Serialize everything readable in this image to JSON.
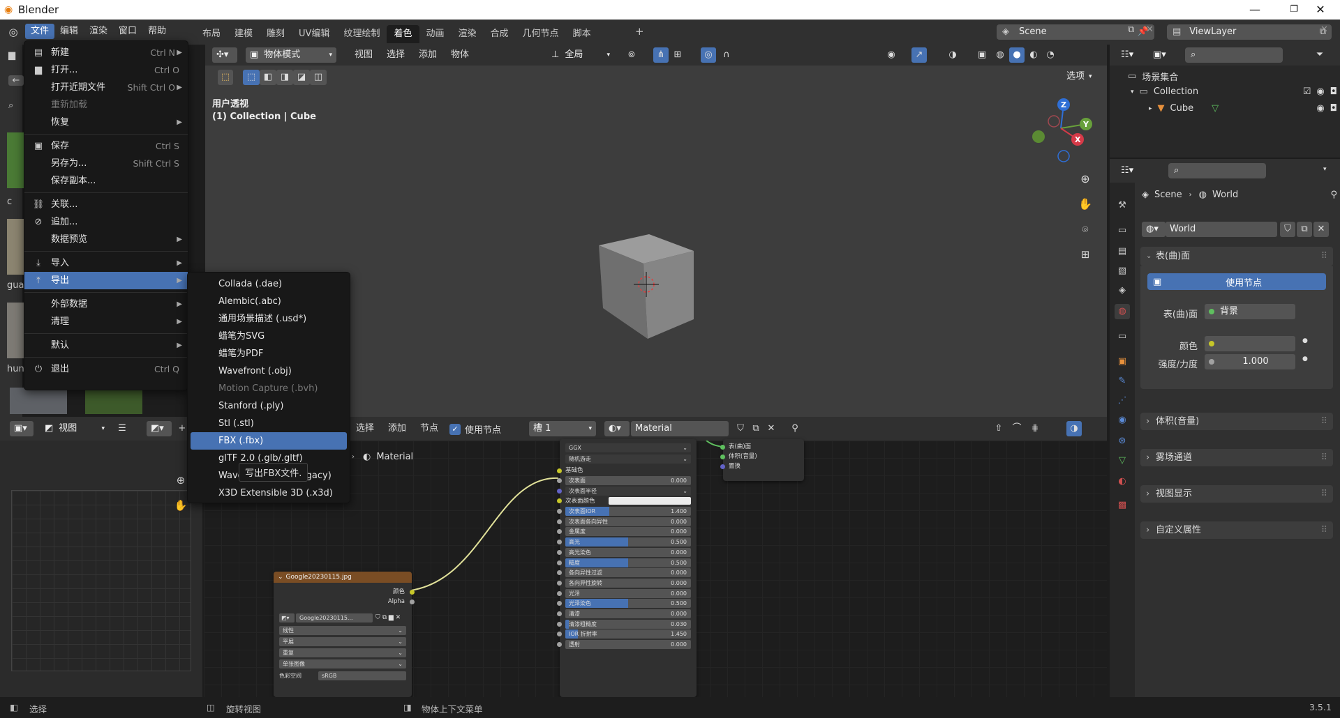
{
  "window": {
    "title": "Blender"
  },
  "topbar": {
    "menus": [
      "文件",
      "编辑",
      "渲染",
      "窗口",
      "帮助"
    ],
    "workspaces": [
      "布局",
      "建模",
      "雕刻",
      "UV编辑",
      "纹理绘制",
      "着色",
      "动画",
      "渲染",
      "合成",
      "几何节点",
      "脚本"
    ],
    "active_workspace": "着色",
    "scene": "Scene",
    "view_layer": "ViewLayer"
  },
  "file_menu": {
    "items": [
      {
        "label": "新建",
        "shortcut": "Ctrl N",
        "icon": "new-file-icon",
        "submenu": true
      },
      {
        "label": "打开...",
        "shortcut": "Ctrl O",
        "icon": "folder-icon"
      },
      {
        "label": "打开近期文件",
        "shortcut": "Shift Ctrl O",
        "submenu": true
      },
      {
        "label": "重新加载",
        "disabled": true
      },
      {
        "label": "恢复",
        "submenu": true
      },
      {
        "label": "保存",
        "shortcut": "Ctrl S",
        "icon": "save-icon",
        "sep_before": true
      },
      {
        "label": "另存为...",
        "shortcut": "Shift Ctrl S"
      },
      {
        "label": "保存副本..."
      },
      {
        "label": "关联...",
        "icon": "link-icon",
        "sep_before": true
      },
      {
        "label": "追加...",
        "icon": "append-icon"
      },
      {
        "label": "数据预览",
        "submenu": true
      },
      {
        "label": "导入",
        "icon": "import-icon",
        "submenu": true,
        "sep_before": true
      },
      {
        "label": "导出",
        "icon": "export-icon",
        "submenu": true,
        "highlight": true
      },
      {
        "label": "外部数据",
        "submenu": true,
        "sep_before": true
      },
      {
        "label": "清理",
        "submenu": true
      },
      {
        "label": "默认",
        "submenu": true,
        "sep_before": true
      },
      {
        "label": "退出",
        "shortcut": "Ctrl Q",
        "icon": "power-icon",
        "sep_before": true
      }
    ]
  },
  "export_menu": {
    "items": [
      {
        "label": "Collada (.dae)"
      },
      {
        "label": "Alembic(.abc)"
      },
      {
        "label": "通用场景描述 (.usd*)"
      },
      {
        "label": "蜡笔为SVG"
      },
      {
        "label": "蜡笔为PDF"
      },
      {
        "label": "Wavefront (.obj)"
      },
      {
        "label": "Motion Capture (.bvh)",
        "disabled": true
      },
      {
        "label": "Stanford (.ply)"
      },
      {
        "label": "Stl (.stl)"
      },
      {
        "label": "FBX (.fbx)",
        "highlight": true
      },
      {
        "label": "glTF 2.0 (.glb/.gltf)"
      },
      {
        "label": "Wavefront (.obj) (legacy)"
      },
      {
        "label": "X3D Extensible 3D (.x3d)"
      }
    ],
    "tooltip": "写出FBX文件."
  },
  "viewport": {
    "mode": "物体模式",
    "menus": [
      "视图",
      "选择",
      "添加",
      "物体"
    ],
    "transform": "全局",
    "options": "选项",
    "view_name": "用户透视",
    "context": "(1) Collection | Cube",
    "axes": {
      "x": "X",
      "y": "Y",
      "z": "Z"
    }
  },
  "left_panel": {
    "thumbs": [
      "c",
      "gua",
      "hun"
    ]
  },
  "image_editor": {
    "view": "视图"
  },
  "node_editor": {
    "menus": [
      "选择",
      "添加",
      "节点"
    ],
    "use_nodes": "使用节点",
    "slot": "槽 1",
    "material": "Material",
    "breadcrumb": "Material",
    "image_node": {
      "title": "Google20230115.jpg",
      "outputs": [
        "颜色",
        "Alpha"
      ],
      "image": "Google20230115...",
      "dropdowns": [
        "线性",
        "平展",
        "重复",
        "单张图像"
      ],
      "colorspace_label": "色彩空间",
      "colorspace": "sRGB"
    },
    "bsdf": {
      "dropdowns": [
        "GGX",
        "随机游走"
      ],
      "base_color": "基础色",
      "rows": [
        {
          "label": "次表面",
          "value": "0.000",
          "fill": 0
        },
        {
          "label": "次表面半径",
          "dropdown": true
        },
        {
          "label": "次表面颜色",
          "color": true
        },
        {
          "label": "次表面IOR",
          "value": "1.400",
          "fill": 0.35
        },
        {
          "label": "次表面各向异性",
          "value": "0.000",
          "fill": 0
        },
        {
          "label": "金属度",
          "value": "0.000",
          "fill": 0
        },
        {
          "label": "高光",
          "value": "0.500",
          "fill": 0.5
        },
        {
          "label": "高光染色",
          "value": "0.000",
          "fill": 0
        },
        {
          "label": "糙度",
          "value": "0.500",
          "fill": 0.5
        },
        {
          "label": "各向异性过滤",
          "value": "0.000",
          "fill": 0
        },
        {
          "label": "各向异性旋转",
          "value": "0.000",
          "fill": 0
        },
        {
          "label": "光泽",
          "value": "0.000",
          "fill": 0
        },
        {
          "label": "光泽染色",
          "value": "0.500",
          "fill": 0.5
        },
        {
          "label": "清漆",
          "value": "0.000",
          "fill": 0
        },
        {
          "label": "清漆粗糙度",
          "value": "0.030",
          "fill": 0.03
        },
        {
          "label": "IOR 折射率",
          "value": "1.450",
          "fill": 0.1
        },
        {
          "label": "透射",
          "value": "0.000",
          "fill": 0
        }
      ]
    },
    "output_node": {
      "rows": [
        "表(曲)面",
        "体积(音量)",
        "置换"
      ]
    }
  },
  "outliner": {
    "root": "场景集合",
    "collection": "Collection",
    "object": "Cube"
  },
  "properties": {
    "breadcrumb_scene": "Scene",
    "breadcrumb_world": "World",
    "world_name": "World",
    "surface_section": "表(曲)面",
    "use_nodes_btn": "使用节点",
    "surface_label": "表(曲)面",
    "surface_value": "背景",
    "color_label": "颜色",
    "strength_label": "强度/力度",
    "strength_value": "1.000",
    "sections": [
      "体积(音量)",
      "雾场通道",
      "视图显示",
      "自定义属性"
    ]
  },
  "statusbar": {
    "select": "选择",
    "rotate": "旋转视图",
    "context_menu": "物体上下文菜单",
    "version": "3.5.1"
  },
  "colors": {
    "accent": "#4772b3",
    "header": "#303030",
    "panel": "#393939",
    "menu": "#181818"
  }
}
